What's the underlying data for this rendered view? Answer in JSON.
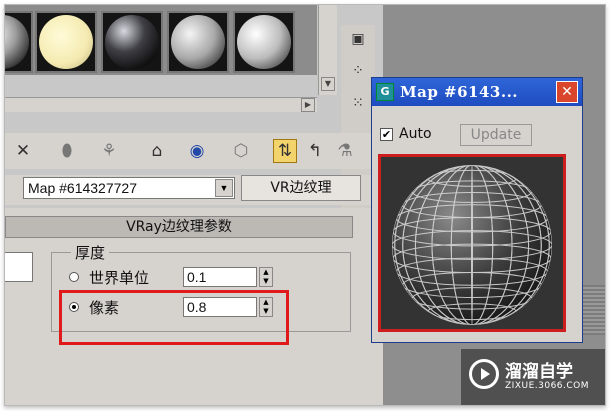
{
  "map_window": {
    "title": "Map #6143...",
    "auto_label": "Auto",
    "auto_checked": true,
    "update_label": "Update"
  },
  "toolbar": {
    "icons": [
      "close-x-icon",
      "assign-material-icon",
      "make-unique-icon",
      "put-to-library-icon",
      "material-id-icon",
      "show-map-icon",
      "show-end-result-icon",
      "go-to-parent-icon",
      "go-forward-sibling-icon"
    ]
  },
  "map_row": {
    "map_name": "Map #614327727",
    "map_type": "VR边纹理"
  },
  "params": {
    "rollout_title": "VRay边纹理参数",
    "group_title": "厚度",
    "world_units_label": "世界单位",
    "world_units_value": "0.1",
    "pixels_label": "像素",
    "pixels_value": "0.8",
    "selected_mode": "pixels"
  },
  "watermark": {
    "title": "溜溜自学",
    "subtitle": "ZIXUE.3066.COM"
  },
  "colors": {
    "titlebar": "#2f66d8",
    "highlight_red": "#e0191b",
    "active_tool": "#f3d36b"
  }
}
